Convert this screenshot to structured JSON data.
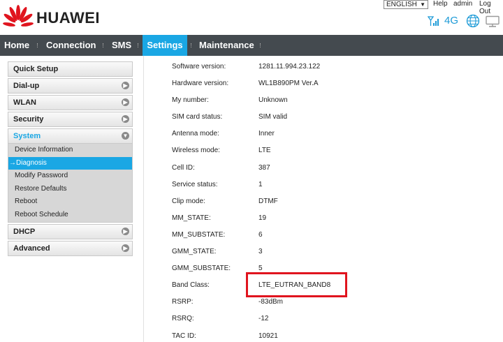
{
  "header": {
    "brand": "HUAWEI",
    "language": "ENGLISH",
    "links": {
      "help": "Help",
      "admin": "admin",
      "logout": "Log Out"
    },
    "network_type": "4G",
    "accent_color": "#1aa7e4"
  },
  "nav": {
    "items": [
      {
        "label": "Home",
        "active": false
      },
      {
        "label": "Connection",
        "active": false
      },
      {
        "label": "SMS",
        "active": false
      },
      {
        "label": "Settings",
        "active": true
      },
      {
        "label": "Maintenance",
        "active": false
      }
    ]
  },
  "sidebar": {
    "quick_setup": "Quick Setup",
    "dialup": "Dial-up",
    "wlan": "WLAN",
    "security": "Security",
    "system": "System",
    "system_items": [
      "Device Information",
      "→Diagnosis",
      "Modify Password",
      "Restore Defaults",
      "Reboot",
      "Reboot Schedule"
    ],
    "dhcp": "DHCP",
    "advanced": "Advanced"
  },
  "info": {
    "rows": [
      {
        "label": "Software version:",
        "value": "1281.11.994.23.122"
      },
      {
        "label": "Hardware version:",
        "value": "WL1B890PM Ver.A"
      },
      {
        "label": "My number:",
        "value": "Unknown"
      },
      {
        "label": "SIM card status:",
        "value": "SIM valid"
      },
      {
        "label": "Antenna mode:",
        "value": "Inner"
      },
      {
        "label": "Wireless mode:",
        "value": "LTE"
      },
      {
        "label": "Cell ID:",
        "value": "387"
      },
      {
        "label": "Service status:",
        "value": "1"
      },
      {
        "label": "Clip mode:",
        "value": "DTMF"
      },
      {
        "label": "MM_STATE:",
        "value": "19"
      },
      {
        "label": "MM_SUBSTATE:",
        "value": "6"
      },
      {
        "label": "GMM_STATE:",
        "value": "3"
      },
      {
        "label": "GMM_SUBSTATE:",
        "value": "5"
      },
      {
        "label": "Band Class:",
        "value": "LTE_EUTRAN_BAND8"
      },
      {
        "label": "RSRP:",
        "value": "-83dBm"
      },
      {
        "label": "RSRQ:",
        "value": "-12"
      },
      {
        "label": "TAC ID:",
        "value": "10921"
      }
    ]
  }
}
